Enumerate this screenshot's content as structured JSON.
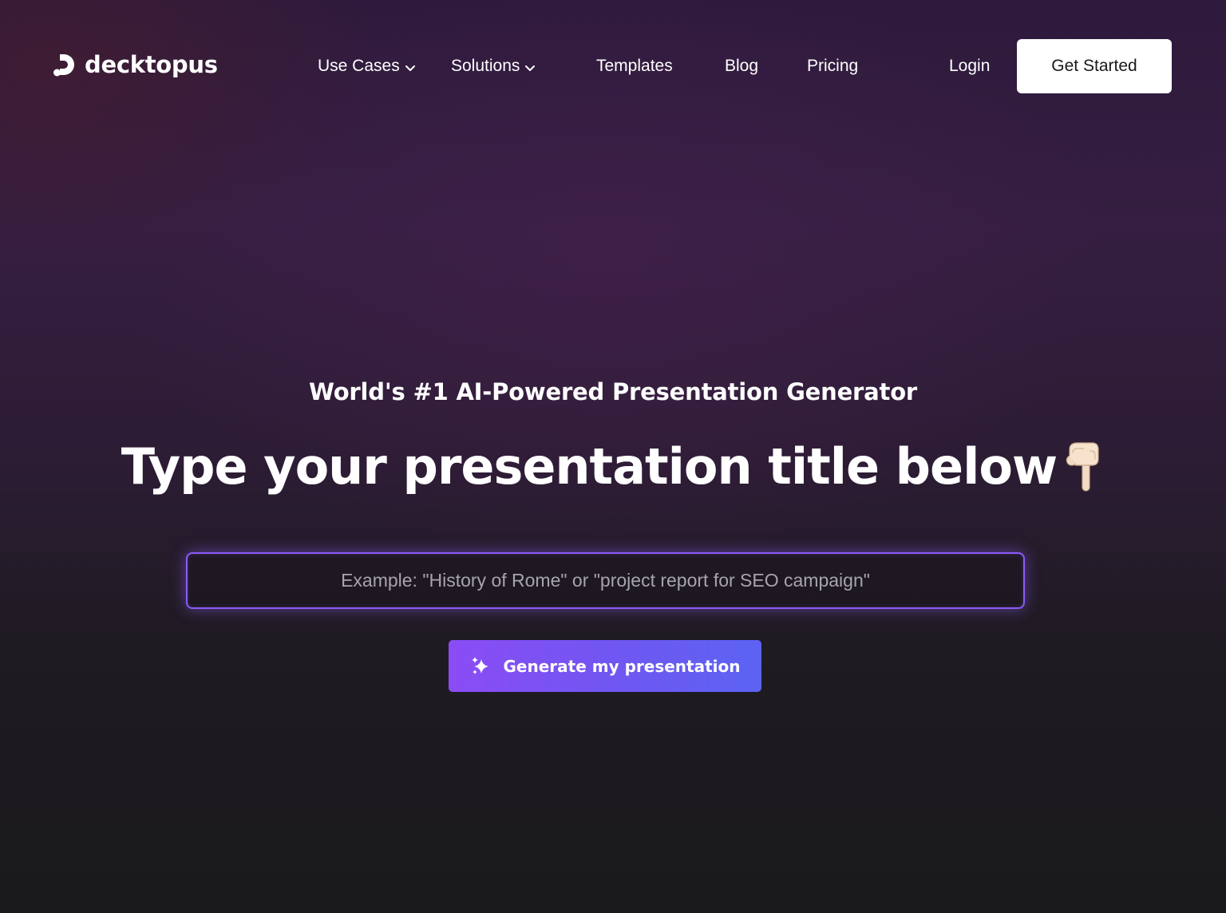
{
  "brand": {
    "name": "decktopus",
    "icon": "decktopus-logo-icon"
  },
  "nav": {
    "items": [
      {
        "label": "Use Cases",
        "has_dropdown": true
      },
      {
        "label": "Solutions",
        "has_dropdown": true
      },
      {
        "label": "Templates",
        "has_dropdown": false
      },
      {
        "label": "Blog",
        "has_dropdown": false
      },
      {
        "label": "Pricing",
        "has_dropdown": false
      }
    ],
    "login_label": "Login",
    "cta_label": "Get Started"
  },
  "hero": {
    "subtitle": "World's #1 AI-Powered Presentation Generator",
    "headline": "Type your presentation title below",
    "headline_icon": "pointing-down-hand-icon",
    "input": {
      "value": "",
      "placeholder": "Example: \"History of Rome\" or \"project report for SEO campaign\""
    },
    "generate_label": "Generate my presentation",
    "generate_icon": "sparkle-icon"
  },
  "colors": {
    "accent": "#8b5cf6",
    "button_gradient_start": "#8b4cf4",
    "button_gradient_end": "#5c63f3",
    "cta_bg": "#ffffff"
  }
}
